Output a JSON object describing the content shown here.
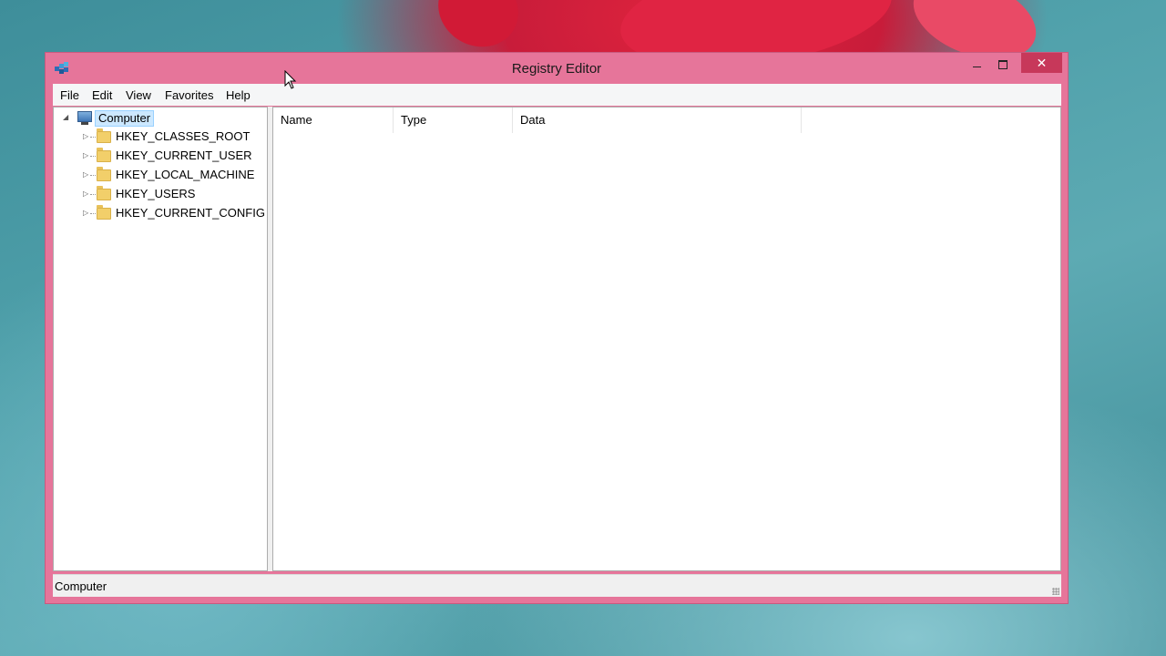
{
  "window": {
    "title": "Registry Editor",
    "close_glyph": "✕"
  },
  "menu": [
    "File",
    "Edit",
    "View",
    "Favorites",
    "Help"
  ],
  "tree": {
    "root": "Computer",
    "items": [
      "HKEY_CLASSES_ROOT",
      "HKEY_CURRENT_USER",
      "HKEY_LOCAL_MACHINE",
      "HKEY_USERS",
      "HKEY_CURRENT_CONFIG"
    ]
  },
  "list": {
    "columns": [
      "Name",
      "Type",
      "Data"
    ]
  },
  "status": {
    "text": "Computer"
  },
  "colors": {
    "titlebar": "#e6759a",
    "close_button": "#c7385a"
  }
}
